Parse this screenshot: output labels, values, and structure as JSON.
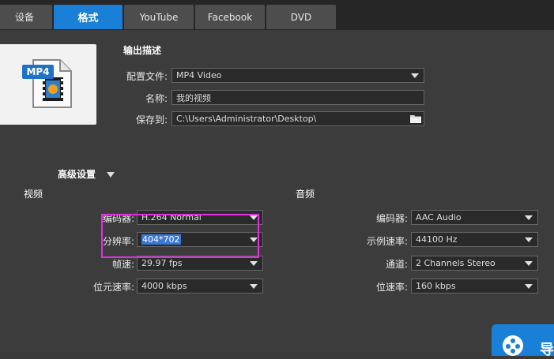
{
  "tabs": [
    {
      "label": "设备"
    },
    {
      "label": "格式"
    },
    {
      "label": "YouTube"
    },
    {
      "label": "Facebook"
    },
    {
      "label": "DVD"
    }
  ],
  "thumbnail": {
    "badge": "MP4"
  },
  "output": {
    "title": "输出描述",
    "profile_label": "配置文件:",
    "profile_value": "MP4 Video",
    "name_label": "名称:",
    "name_value": "我的视频",
    "save_label": "保存到:",
    "save_value": "C:\\Users\\Administrator\\Desktop\\"
  },
  "advanced": {
    "title": "高级设置",
    "video": {
      "title": "视频",
      "encoder_label": "编码器:",
      "encoder_value": "H.264 Normal",
      "resolution_label": "分辨率:",
      "resolution_value": "404*702",
      "framerate_label": "帧速:",
      "framerate_value": "29.97 fps",
      "bitrate_label": "位元速率:",
      "bitrate_value": "4000 kbps"
    },
    "audio": {
      "title": "音频",
      "encoder_label": "编码器:",
      "encoder_value": "AAC Audio",
      "samplerate_label": "示例速率:",
      "samplerate_value": "44100 Hz",
      "channel_label": "通道:",
      "channel_value": "2 Channels Stereo",
      "bitrate_label": "位速率:",
      "bitrate_value": "160 kbps"
    }
  },
  "convert": {
    "label": "导"
  },
  "colors": {
    "accent": "#1a7fd6",
    "highlight_box": "#e030e0"
  }
}
